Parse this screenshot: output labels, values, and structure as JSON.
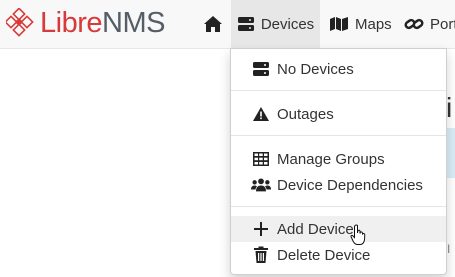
{
  "brand": {
    "logo_text_red": "Libre",
    "logo_text_gray": "NMS"
  },
  "nav": {
    "home_icon": "home-icon",
    "devices_label": "Devices",
    "maps_label": "Maps",
    "ports_label": "Port"
  },
  "dropdown": {
    "items": [
      {
        "label": "No Devices",
        "icon": "server-icon"
      },
      {
        "label": "Outages",
        "icon": "warning-icon"
      },
      {
        "label": "Manage Groups",
        "icon": "grid-icon"
      },
      {
        "label": "Device Dependencies",
        "icon": "users-icon"
      },
      {
        "label": "Add Device",
        "icon": "plus-icon"
      },
      {
        "label": "Delete Device",
        "icon": "trash-icon"
      }
    ]
  },
  "background": {
    "heading_peek": "vi",
    "side_peek": "I"
  },
  "colors": {
    "brand_red": "#d73a3a",
    "brand_gray": "#555d66",
    "navbar_bg": "#f8f8f8",
    "active_nav_bg": "#e7e7e7"
  }
}
